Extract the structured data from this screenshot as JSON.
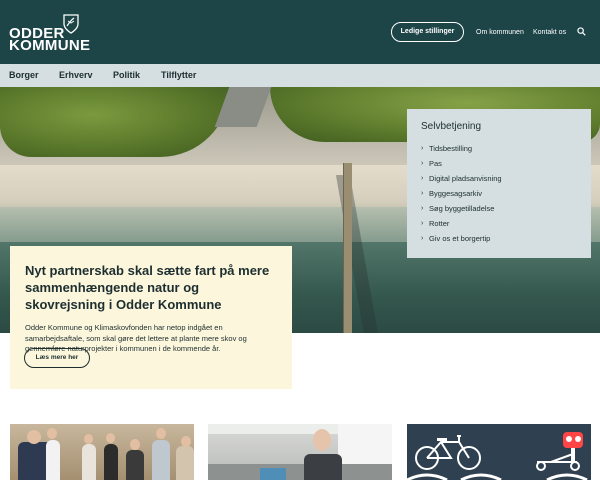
{
  "header": {
    "logo_line1": "ODDER",
    "logo_line2": "KOMMUNE",
    "jobs_button": "Ledige stillinger",
    "about_link": "Om kommunen",
    "contact_link": "Kontakt os",
    "search_icon": "search-icon"
  },
  "nav": {
    "items": [
      {
        "label": "Borger"
      },
      {
        "label": "Erhverv"
      },
      {
        "label": "Politik"
      },
      {
        "label": "Tilflytter"
      }
    ]
  },
  "self_service": {
    "title": "Selvbetjening",
    "items": [
      {
        "label": "Tidsbestilling"
      },
      {
        "label": "Pas"
      },
      {
        "label": "Digital pladsanvisning"
      },
      {
        "label": "Byggesagsarkiv"
      },
      {
        "label": "Søg byggetilladelse"
      },
      {
        "label": "Rotter"
      },
      {
        "label": "Giv os et borgertip"
      }
    ]
  },
  "news": {
    "title": "Nyt partnerskab skal sætte fart på mere sammenhængende natur og skovrejsning i Odder Kommune",
    "body": "Odder Kommune og Klimaskovfonden har netop indgået en samarbejdsaftale, som skal gøre det lettere at plante mere skov og gennemføre naturprojekter i kommunen i de kommende år.",
    "button": "Læs mere her"
  },
  "colors": {
    "header_bg": "#1d4447",
    "nav_bg": "#d5dfe1",
    "card_bg": "#fcf6dc"
  }
}
